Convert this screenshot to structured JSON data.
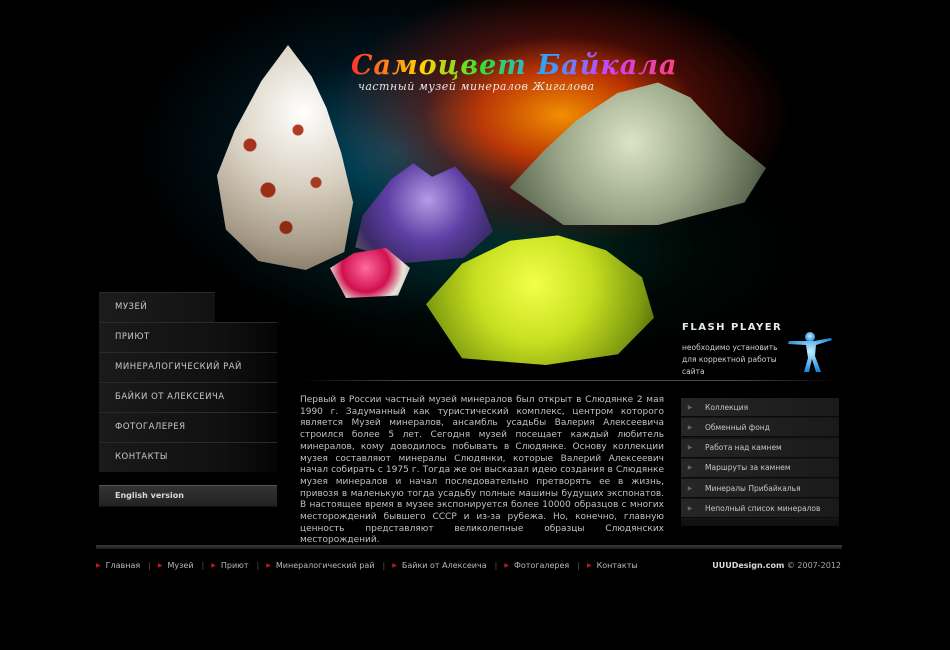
{
  "header": {
    "title": "Самоцвет Байкала",
    "subtitle": "частный музей минералов Жигалова"
  },
  "flash": {
    "title": "FLASH PLAYER",
    "note": "необходимо установить для корректной работы сайта",
    "icon": "person-icon"
  },
  "left_menu": {
    "items": [
      {
        "label": "МУЗЕЙ"
      },
      {
        "label": "ПРИЮТ"
      },
      {
        "label": "МИНЕРАЛОГИЧЕСКИЙ РАЙ"
      },
      {
        "label": "БАЙКИ ОТ АЛЕКСЕИЧА"
      },
      {
        "label": "ФОТОГАЛЕРЕЯ"
      },
      {
        "label": "КОНТАКТЫ"
      }
    ],
    "lang_button": "English version"
  },
  "main": {
    "intro": "Первый в России частный музей минералов был открыт в Слюдянке 2 мая 1990 г. Задуманный как туристический комплекс, центром которого является Музей минералов, ансамбль усадьбы Валерия Алексеевича строился более 5 лет. Сегодня музей посещает каждый любитель минералов, кому доводилось побывать в Слюдянке. Основу коллекции музея составляют минералы Слюдянки, которые Валерий Алексеевич начал собирать с 1975 г. Тогда же он высказал идею создания в Слюдянке музея минералов и начал последовательно претворять ее в жизнь, привозя в маленькую тогда усадьбу полные машины будущих экспонатов. В настоящее время в музее экспонируется более 10000 образцов с многих месторождений бывшего СССР и из-за рубежа. Но, конечно, главную ценность представляют великолепные образцы Слюдянских месторождений."
  },
  "right_menu": {
    "items": [
      {
        "label": "Коллекция"
      },
      {
        "label": "Обменный фонд"
      },
      {
        "label": "Работа над камнем"
      },
      {
        "label": "Маршруты за камнем"
      },
      {
        "label": "Минералы Прибайкалья"
      },
      {
        "label": "Неполный список минералов"
      }
    ]
  },
  "footer": {
    "nav": [
      {
        "label": "Главная"
      },
      {
        "label": "Музей"
      },
      {
        "label": "Приют"
      },
      {
        "label": "Минералогический рай"
      },
      {
        "label": "Байки от Алексеича"
      },
      {
        "label": "Фотогалерея"
      },
      {
        "label": "Контакты"
      }
    ],
    "credit_brand": "UUUDesign.com",
    "credit_rest": "© 2007-2012"
  },
  "colors": {
    "background": "#000000",
    "footer_bullet": "#c21a1a",
    "hero_glow": "#ff9600"
  }
}
